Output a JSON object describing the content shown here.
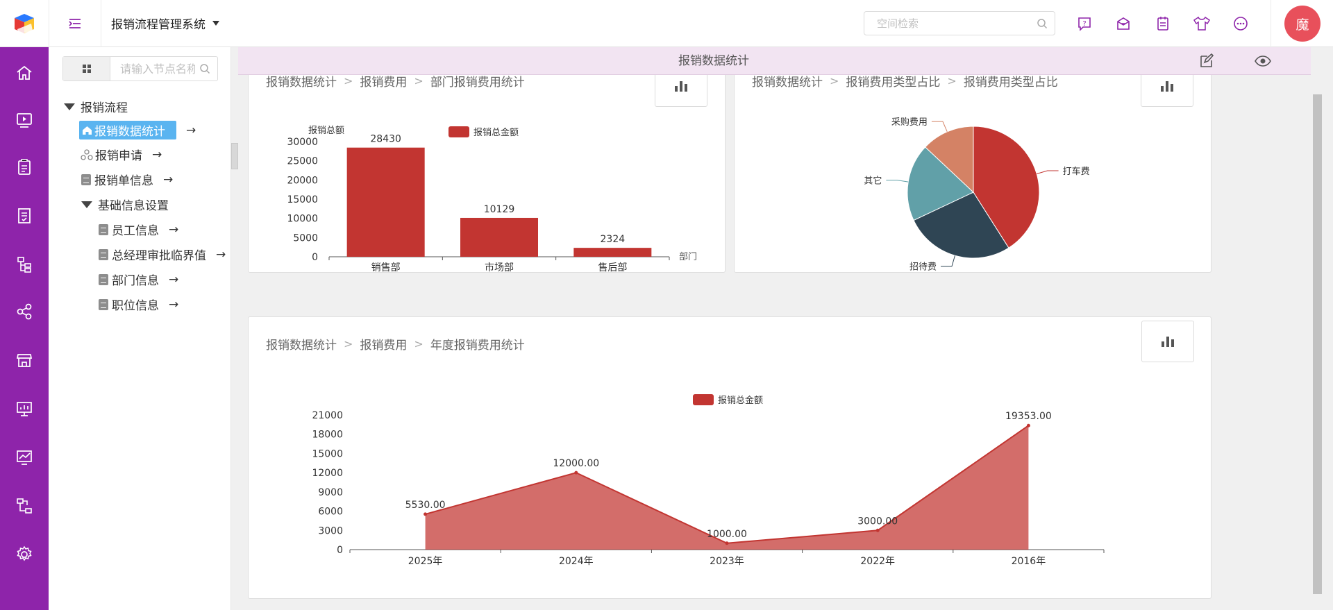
{
  "header": {
    "logo_icon": "app-logo-icon",
    "menu_toggle_icon": "menu-indent-icon",
    "app_title": "报销流程管理系统",
    "search_placeholder": "空间检索",
    "icons": [
      "help-chat-icon",
      "inbox-icon",
      "notebook-icon",
      "tshirt-skin-icon",
      "more-chat-icon"
    ],
    "avatar_text": "魔"
  },
  "sidebar": {
    "icons": [
      "home-icon",
      "video-icon",
      "clipboard-icon",
      "form-check-icon",
      "org-tree-icon",
      "share-icon",
      "store-icon",
      "presentation-icon",
      "chart-trend-icon",
      "flow-icon",
      "gear-icon"
    ]
  },
  "tree": {
    "search_placeholder": "请输入节点名称",
    "root": "报销流程",
    "items": [
      {
        "label": "报销数据统计",
        "arrow": "→"
      },
      {
        "label": "报销申请",
        "arrow": "→"
      },
      {
        "label": "报销单信息",
        "arrow": "→"
      },
      {
        "label": "基础信息设置"
      },
      {
        "label": "员工信息",
        "arrow": "→"
      },
      {
        "label": "总经理审批临界值",
        "arrow": "→"
      },
      {
        "label": "部门信息",
        "arrow": "→"
      },
      {
        "label": "职位信息",
        "arrow": "→"
      }
    ]
  },
  "tab": {
    "title": "报销数据统计"
  },
  "cards": {
    "dept": {
      "breadcrumb": [
        "报销数据统计",
        "报销费用",
        "部门报销费用统计"
      ]
    },
    "type": {
      "breadcrumb": [
        "报销数据统计",
        "报销费用类型占比",
        "报销费用类型占比"
      ]
    },
    "year": {
      "breadcrumb": [
        "报销数据统计",
        "报销费用",
        "年度报销费用统计"
      ]
    }
  },
  "colors": {
    "accent": "#8e24aa",
    "series": "#c23531",
    "tab_bg": "#f2e4f2",
    "avatar": "#e8505b"
  },
  "chart_data": [
    {
      "type": "bar",
      "categories": [
        "销售部",
        "市场部",
        "售后部"
      ],
      "series": [
        {
          "name": "报销总金额",
          "values": [
            28430,
            10129,
            2324
          ]
        }
      ],
      "ylabel": "报销总额",
      "xlabel": "部门",
      "ylim": [
        0,
        30000
      ],
      "yticks": [
        "0",
        "5000",
        "10000",
        "15000",
        "20000",
        "25000",
        "30000"
      ],
      "data_labels": [
        "28430",
        "10129",
        "2324"
      ],
      "legend": "top-center",
      "grid": false
    },
    {
      "type": "pie",
      "slices": [
        {
          "label": "打车费",
          "value": 41
        },
        {
          "label": "招待费",
          "value": 27
        },
        {
          "label": "其它",
          "value": 19
        },
        {
          "label": "采购费用",
          "value": 13
        }
      ],
      "colors": [
        "#c23531",
        "#2f4554",
        "#61a0a8",
        "#d48265"
      ]
    },
    {
      "type": "area",
      "categories": [
        "2025年",
        "2024年",
        "2023年",
        "2022年",
        "2016年"
      ],
      "series": [
        {
          "name": "报销总金额",
          "values": [
            5530,
            12000,
            1000,
            3000,
            19353
          ]
        }
      ],
      "data_labels": [
        "5530.00",
        "12000.00",
        "1000.00",
        "3000.00",
        "19353.00"
      ],
      "ylim": [
        0,
        21000
      ],
      "yticks": [
        "0",
        "3000",
        "6000",
        "9000",
        "12000",
        "15000",
        "18000",
        "21000"
      ],
      "legend": "top-center",
      "grid": false
    }
  ]
}
